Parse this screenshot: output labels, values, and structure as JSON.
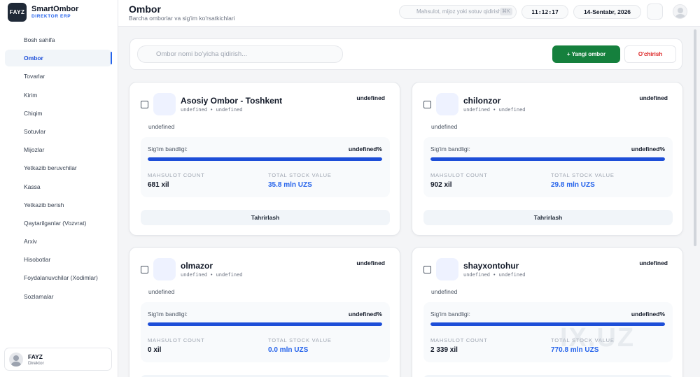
{
  "brand": {
    "logo": "FAYZ",
    "name": "SmartOmbor",
    "subtitle": "DIREKTOR ERP"
  },
  "sidebar": {
    "items": [
      {
        "label": "Bosh sahifa",
        "active": false
      },
      {
        "label": "Ombor",
        "active": true
      },
      {
        "label": "Tovarlar",
        "active": false
      },
      {
        "label": "Kirim",
        "active": false
      },
      {
        "label": "Chiqim",
        "active": false
      },
      {
        "label": "Sotuvlar",
        "active": false
      },
      {
        "label": "Mijozlar",
        "active": false
      },
      {
        "label": "Yetkazib beruvchilar",
        "active": false
      },
      {
        "label": "Kassa",
        "active": false
      },
      {
        "label": "Yetkazib berish",
        "active": false
      },
      {
        "label": "Qaytarilganlar (Vozvrat)",
        "active": false
      },
      {
        "label": "Arxiv",
        "active": false
      },
      {
        "label": "Hisobotlar",
        "active": false
      },
      {
        "label": "Foydalanuvchilar (Xodimlar)",
        "active": false
      },
      {
        "label": "Sozlamalar",
        "active": false
      }
    ],
    "user": {
      "name": "FAYZ",
      "role": "Direktor"
    }
  },
  "header": {
    "title": "Ombor",
    "subtitle": "Barcha omborlar va sig'im ko'rsatkichlari",
    "search_placeholder": "Mahsulot, mijoz yoki sotuv qidirish...",
    "shortcut": "⌘K",
    "time": "11:12:17",
    "date": "14-Sentabr, 2026"
  },
  "toolbar": {
    "search_placeholder": "Ombor nomi bo'yicha qidirish...",
    "add_label": "+ Yangi ombor",
    "delete_label": "O'chirish"
  },
  "labels": {
    "capacity": "Sig'im bandligi:",
    "product_count": "MAHSULOT COUNT",
    "stock_value": "TOTAL STOCK VALUE",
    "edit": "Tahrirlash"
  },
  "warehouses": [
    {
      "name": "Asosiy Ombor - Toshkent",
      "meta": "undefined • undefined",
      "status": "undefined",
      "address": "undefined",
      "capacity": "undefined%",
      "fill_pct": 100,
      "count": "681 xil",
      "value": "35.8 mln UZS"
    },
    {
      "name": "chilonzor",
      "meta": "undefined • undefined",
      "status": "undefined",
      "address": "undefined",
      "capacity": "undefined%",
      "fill_pct": 100,
      "count": "902 xil",
      "value": "29.8 mln UZS"
    },
    {
      "name": "olmazor",
      "meta": "undefined • undefined",
      "status": "undefined",
      "address": "undefined",
      "capacity": "undefined%",
      "fill_pct": 100,
      "count": "0 xil",
      "value": "0.0 mln UZS"
    },
    {
      "name": "shayxontohur",
      "meta": "undefined • undefined",
      "status": "undefined",
      "address": "undefined",
      "capacity": "undefined%",
      "fill_pct": 100,
      "count": "2 339 xil",
      "value": "770.8 mln UZS"
    }
  ],
  "watermark": "IX.UZ",
  "colors": {
    "accent": "#2563eb",
    "add_button": "#15803d",
    "delete_text": "#dc2626",
    "bar_fill": "#1d4ed8"
  }
}
